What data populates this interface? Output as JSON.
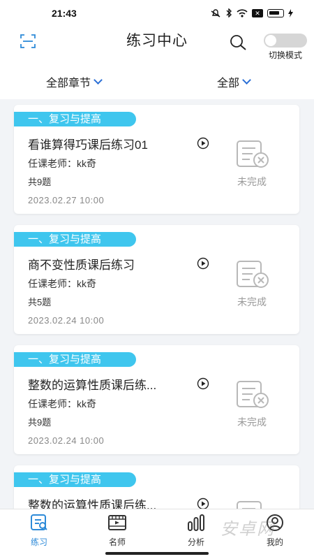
{
  "status_bar": {
    "time": "21:43",
    "icons": [
      "mute-icon",
      "bluetooth-icon",
      "wifi-icon",
      "sim-icon",
      "battery-icon",
      "charging-icon"
    ]
  },
  "header": {
    "title": "练习中心",
    "mode_toggle_label": "切换模式",
    "icons": [
      "scan-icon",
      "search-icon"
    ]
  },
  "filters": {
    "chapter": "全部章节",
    "type": "全部"
  },
  "exercises": [
    {
      "chapter": "一、复习与提高",
      "name": "看谁算得巧课后练习01",
      "teacher": "任课老师：kk奇",
      "count": "共9题",
      "date": "2023.02.27 10:00",
      "status": "未完成"
    },
    {
      "chapter": "一、复习与提高",
      "name": "商不变性质课后练习",
      "teacher": "任课老师：kk奇",
      "count": "共5题",
      "date": "2023.02.24 10:00",
      "status": "未完成"
    },
    {
      "chapter": "一、复习与提高",
      "name": "整数的运算性质课后练...",
      "teacher": "任课老师：kk奇",
      "count": "共9题",
      "date": "2023.02.24 10:00",
      "status": "未完成"
    },
    {
      "chapter": "一、复习与提高",
      "name": "整数的运算性质课后练...",
      "teacher": "",
      "count": "",
      "date": "",
      "status": ""
    }
  ],
  "tabs": [
    {
      "label": "练习",
      "icon": "practice-icon",
      "active": true
    },
    {
      "label": "名师",
      "icon": "video-icon",
      "active": false
    },
    {
      "label": "分析",
      "icon": "chart-icon",
      "active": false
    },
    {
      "label": "我的",
      "icon": "profile-icon",
      "active": false
    }
  ],
  "watermark": "安卓网",
  "colors": {
    "accent": "#2d8ad8",
    "chapter_tag": "#3fc6ee",
    "background": "#f2f4f7"
  }
}
